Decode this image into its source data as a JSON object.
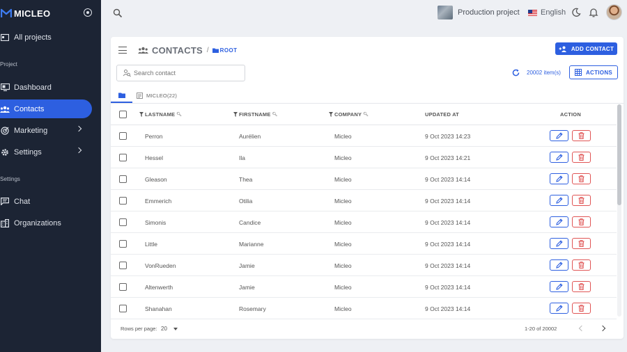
{
  "brand": {
    "name": "MICLEO"
  },
  "sidebar": {
    "all_projects": "All projects",
    "section_project": "Project",
    "section_settings": "Settings",
    "items": [
      {
        "label": "Dashboard",
        "icon": "dashboard-icon"
      },
      {
        "label": "Contacts",
        "icon": "contacts-icon",
        "active": true
      },
      {
        "label": "Marketing",
        "icon": "target-icon"
      },
      {
        "label": "Settings",
        "icon": "gear-icon"
      },
      {
        "label": "Chat",
        "icon": "chat-icon"
      },
      {
        "label": "Organizations",
        "icon": "building-icon"
      }
    ]
  },
  "topbar": {
    "project_name": "Production project",
    "language": "English"
  },
  "header": {
    "title": "CONTACTS",
    "separator": "/",
    "crumb": "ROOT",
    "add_button": "ADD CONTACT"
  },
  "toolbar": {
    "search_placeholder": "Search contact",
    "item_count": "20002 item(s)",
    "actions_button": "ACTIONS"
  },
  "tabs": {
    "micleo": "MICLEO(22)"
  },
  "table": {
    "columns": [
      "LASTNAME",
      "FIRSTNAME",
      "COMPANY",
      "UPDATED AT",
      "ACTION"
    ],
    "rows": [
      {
        "lastname": "Perron",
        "firstname": "Aurélien",
        "company": "Micleo",
        "updated": "9 Oct 2023 14:23"
      },
      {
        "lastname": "Hessel",
        "firstname": "Ila",
        "company": "Micleo",
        "updated": "9 Oct 2023 14:21"
      },
      {
        "lastname": "Gleason",
        "firstname": "Thea",
        "company": "Micleo",
        "updated": "9 Oct 2023 14:14"
      },
      {
        "lastname": "Emmerich",
        "firstname": "Otilia",
        "company": "Micleo",
        "updated": "9 Oct 2023 14:14"
      },
      {
        "lastname": "Simonis",
        "firstname": "Candice",
        "company": "Micleo",
        "updated": "9 Oct 2023 14:14"
      },
      {
        "lastname": "Little",
        "firstname": "Marianne",
        "company": "Micleo",
        "updated": "9 Oct 2023 14:14"
      },
      {
        "lastname": "VonRueden",
        "firstname": "Jamie",
        "company": "Micleo",
        "updated": "9 Oct 2023 14:14"
      },
      {
        "lastname": "Altenwerth",
        "firstname": "Jamie",
        "company": "Micleo",
        "updated": "9 Oct 2023 14:14"
      },
      {
        "lastname": "Shanahan",
        "firstname": "Rosemary",
        "company": "Micleo",
        "updated": "9 Oct 2023 14:14"
      }
    ]
  },
  "pagination": {
    "rows_per_page_label": "Rows per page:",
    "rows_per_page": "20",
    "range": "1-20 of 20002"
  },
  "colors": {
    "accent": "#2d5fe0",
    "sidebar": "#1c2434",
    "danger": "#e05454"
  }
}
